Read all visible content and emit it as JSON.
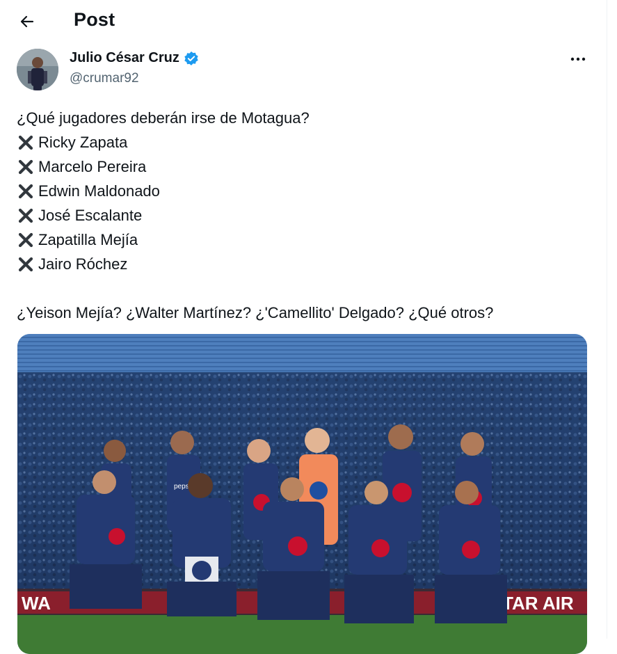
{
  "header": {
    "title": "Post",
    "back_icon": "arrow-left-icon"
  },
  "author": {
    "name": "Julio César Cruz",
    "handle": "@crumar92",
    "verified": true,
    "verified_color": "#1d9bf0"
  },
  "more_icon": "more-horizontal-icon",
  "tweet": {
    "question": "¿Qué jugadores deberán irse de Motagua?",
    "list_icon": "cross-mark-icon",
    "players": [
      "Ricky Zapata",
      "Marcelo Pereira",
      "Edwin Maldonado",
      "José Escalante",
      "Zapatilla Mejía",
      "Jairo Róchez"
    ],
    "followup": "¿Yeison Mejía? ¿Walter Martínez? ¿'Camellito' Delgado? ¿Qué otros?"
  },
  "media": {
    "jersey_sponsor": "pepsi",
    "banner_left": "WA",
    "banner_right": "QATAR AIR",
    "colors": {
      "kit": "#243a73",
      "keeper": "#f28a5b",
      "stand": "#2d5d9c"
    }
  }
}
